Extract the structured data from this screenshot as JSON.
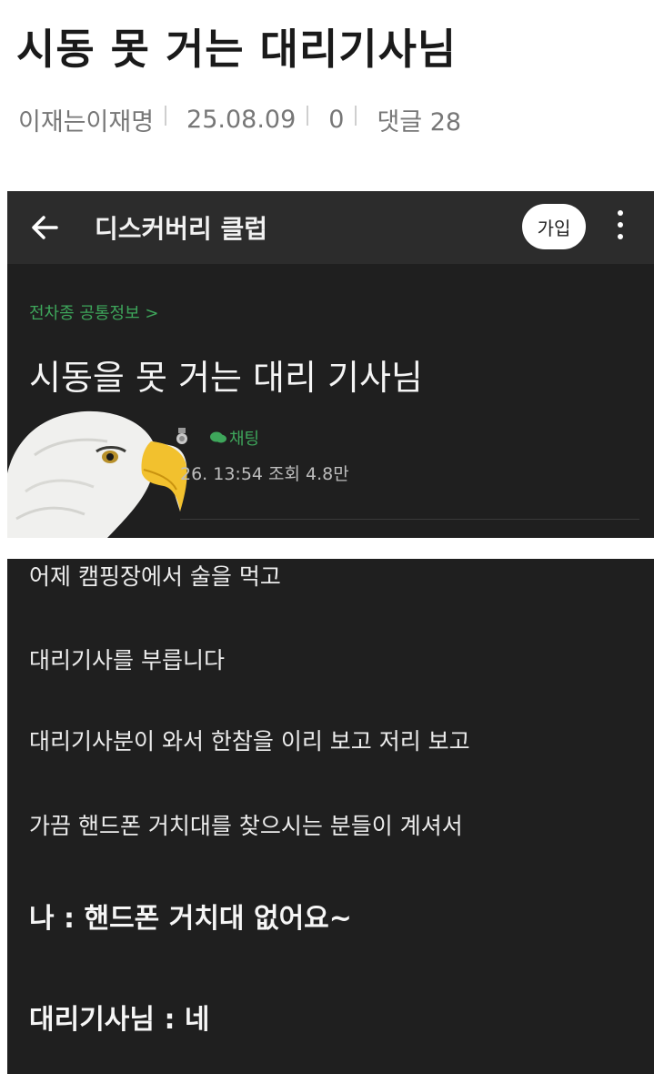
{
  "post": {
    "title": "시동 못 거는 대리기사님",
    "author": "이재는이재명",
    "date": "25.08.09",
    "likes": "0",
    "comments": "댓글 28"
  },
  "screenshot1": {
    "club_name": "디스커버리 클럽",
    "join_label": "가입",
    "breadcrumb": "전차종 공통정보 >",
    "title": "시동을 못 거는 대리 기사님",
    "chat_label": "채팅",
    "post_meta": "26. 13:54  조회 4.8만"
  },
  "screenshot2": {
    "lines": [
      "어제 캠핑장에서 술을 먹고",
      "대리기사를 부릅니다",
      "대리기사분이 와서 한참을 이리 보고 저리 보고",
      "가끔 핸드폰 거치대를 찾으시는 분들이 계셔서",
      "나 : 핸드폰 거치대 없어요~",
      "대리기사님 : 네"
    ]
  },
  "colors": {
    "accent_green": "#3ea65b",
    "dark_bg": "#1f1f1f",
    "appbar_bg": "#2c2c2c"
  }
}
